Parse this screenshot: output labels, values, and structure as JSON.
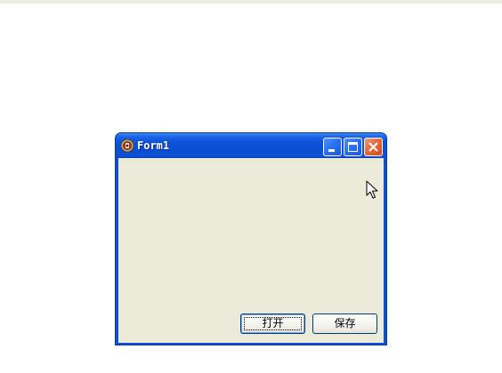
{
  "window": {
    "title": "Form1",
    "icon": "delphi-app-icon"
  },
  "caption_buttons": {
    "minimize": "minimize-icon",
    "maximize": "maximize-icon",
    "close": "close-icon"
  },
  "buttons": {
    "open_label": "打开",
    "save_label": "保存"
  },
  "colors": {
    "titlebar": "#0a4fd6",
    "client": "#ecead9",
    "close_button": "#e36b3e"
  }
}
